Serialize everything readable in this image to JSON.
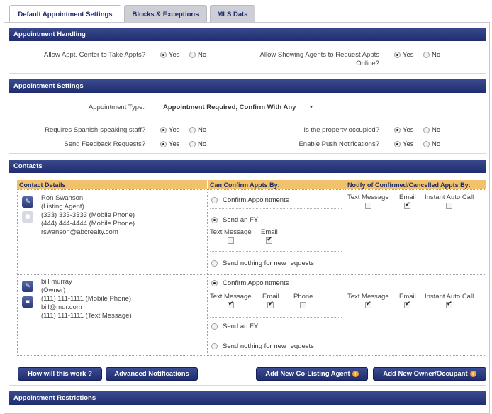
{
  "tabs": [
    {
      "label": "Default Appointment Settings"
    },
    {
      "label": "Blocks & Exceptions"
    },
    {
      "label": "MLS Data"
    }
  ],
  "handling": {
    "title": "Appointment Handling",
    "allow_center_label": "Allow Appt. Center to Take Appts?",
    "allow_agents_label": "Allow Showing Agents to Request Appts Online?",
    "yes": "Yes",
    "no": "No"
  },
  "settings": {
    "title": "Appointment Settings",
    "type_label": "Appointment Type:",
    "type_value": "Appointment Required, Confirm With Any",
    "spanish_label": "Requires Spanish-speaking staff?",
    "occupied_label": "Is the property occupied?",
    "feedback_label": "Send Feedback Requests?",
    "push_label": "Enable Push Notifications?",
    "yes": "Yes",
    "no": "No"
  },
  "contacts": {
    "title": "Contacts",
    "col_details": "Contact Details",
    "col_confirm": "Can Confirm Appts By:",
    "col_notify": "Notify of Confirmed/Cancelled Appts By:",
    "contact1": {
      "name": "Ron Swanson",
      "role": "(Listing Agent)",
      "phone1": "(333) 333-3333 (Mobile Phone)",
      "phone2": "(444) 444-4444 (Mobile Phone)",
      "email": "rswanson@abcrealty.com",
      "confirm_appts": "Confirm Appointments",
      "send_fyi": "Send an FYI",
      "text_message": "Text Message",
      "email_label": "Email",
      "send_nothing": "Send nothing for new requests",
      "notify_text": "Text Message",
      "notify_email": "Email",
      "notify_auto": "Instant Auto Call"
    },
    "contact2": {
      "name": "bill murray",
      "role": "(Owner)",
      "phone1": "(111) 111-1111 (Mobile Phone)",
      "email": "bill@mur.com",
      "phone2": "(111) 111-1111 (Text Message)",
      "confirm_appts": "Confirm Appointments",
      "text_message": "Text Message",
      "email_label": "Email",
      "phone_label": "Phone",
      "send_fyi": "Send an FYI",
      "send_nothing": "Send nothing for new requests",
      "notify_text": "Text Message",
      "notify_email": "Email",
      "notify_auto": "Instant Auto Call"
    }
  },
  "buttons": {
    "how_works": "How will this work ?",
    "advanced": "Advanced Notifications",
    "add_colisting": "Add New Co-Listing Agent",
    "add_owner": "Add New Owner/Occupant"
  },
  "restrictions": {
    "title": "Appointment Restrictions"
  },
  "icons": {
    "edit": "pencil-icon",
    "user": "person-icon",
    "delete": "trash-icon",
    "add": "plus-icon",
    "dropdown": "triangle-down-icon"
  },
  "colors": {
    "header_navy": "#1f2d6e",
    "table_header": "#f2c16b",
    "add_orange": "#f2a034"
  }
}
